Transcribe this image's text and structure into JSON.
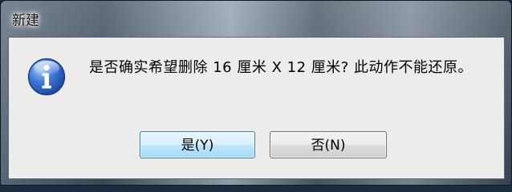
{
  "window": {
    "title": "新建"
  },
  "dialog": {
    "icon": "info-icon",
    "message": "是否确实希望删除 16 厘米 X 12 厘米? 此动作不能还原。"
  },
  "buttons": {
    "yes_label": "是(Y)",
    "no_label": "否(N)"
  },
  "colors": {
    "icon_blue": "#2a63c6",
    "default_button_border": "#3c7fb1",
    "client_background": "#ececec"
  }
}
